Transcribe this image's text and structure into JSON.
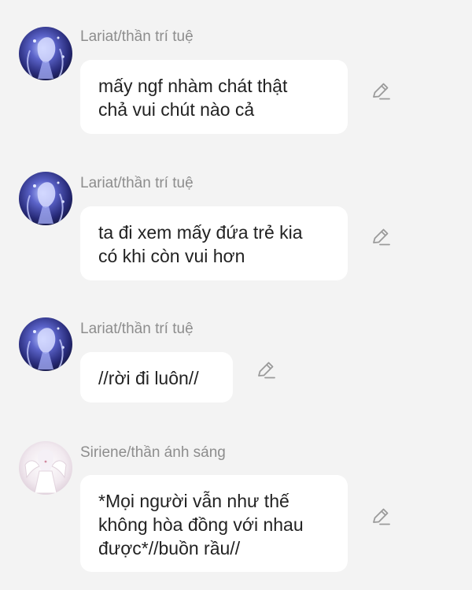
{
  "messages": [
    {
      "author": "Lariat/thần trí tuệ",
      "avatar_icon": "blue-fantasy-character-avatar",
      "lines": [
        "mấy ngf nhàm chát thật",
        "chả vui chút nào cả"
      ],
      "edit_icon": "pencil-edit-icon"
    },
    {
      "author": "Lariat/thần trí tuệ",
      "avatar_icon": "blue-fantasy-character-avatar",
      "lines": [
        "ta đi xem mấy đứa trẻ kia",
        "có khi còn vui hơn"
      ],
      "edit_icon": "pencil-edit-icon"
    },
    {
      "author": "Lariat/thần trí tuệ",
      "avatar_icon": "blue-fantasy-character-avatar",
      "lines": [
        "//rời đi luôn//"
      ],
      "edit_icon": "pencil-edit-icon"
    },
    {
      "author": "Siriene/thần ánh sáng",
      "avatar_icon": "white-winged-character-avatar",
      "lines": [
        "*Mọi người vẫn như thế",
        "không hòa đồng với nhau",
        "được*//buồn rầu//"
      ],
      "edit_icon": "pencil-edit-icon"
    }
  ],
  "colors": {
    "background": "#f3f3f3",
    "bubble": "#ffffff",
    "author_text": "#8d8d8d",
    "message_text": "#222222",
    "icon": "#9a9a9a"
  }
}
